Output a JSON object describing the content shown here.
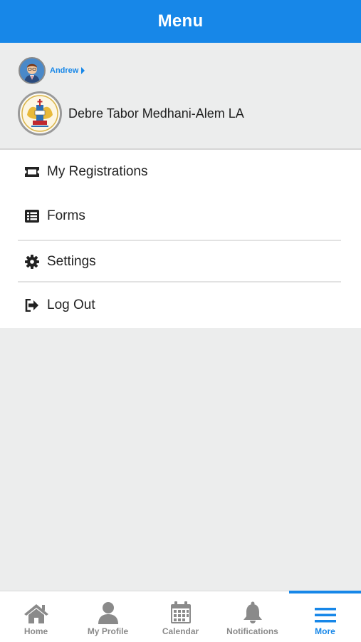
{
  "header": {
    "title": "Menu"
  },
  "profile": {
    "user_name": "Andrew",
    "organization_name": "Debre Tabor Medhani-Alem LA"
  },
  "menu": {
    "items": [
      {
        "label": "My Registrations",
        "icon": "ticket-icon"
      },
      {
        "label": "Forms",
        "icon": "list-icon"
      },
      {
        "label": "Settings",
        "icon": "gear-icon"
      },
      {
        "label": "Log Out",
        "icon": "logout-icon"
      }
    ]
  },
  "tabbar": {
    "tabs": [
      {
        "label": "Home",
        "icon": "home-icon"
      },
      {
        "label": "My Profile",
        "icon": "person-icon"
      },
      {
        "label": "Calendar",
        "icon": "calendar-icon"
      },
      {
        "label": "Notifications",
        "icon": "bell-icon"
      },
      {
        "label": "More",
        "icon": "hamburger-icon",
        "active": true
      }
    ]
  },
  "colors": {
    "accent": "#1787e8",
    "inactive": "#8a8a8a",
    "background": "#eceded"
  }
}
